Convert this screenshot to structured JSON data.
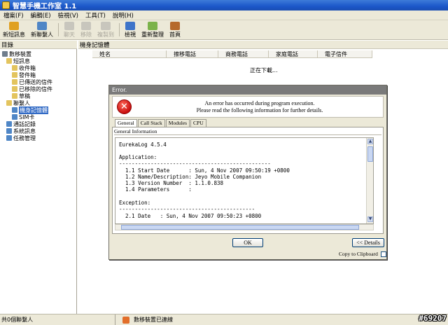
{
  "window": {
    "title": "智慧手機工作室 1.1"
  },
  "menu": [
    "檔案(F)",
    "編輯(E)",
    "檢視(V)",
    "工具(T)",
    "說明(H)"
  ],
  "toolbar": {
    "buttons": [
      {
        "label": "新短訊息",
        "icon": "new-message-icon",
        "disabled": false,
        "color": "#e0a020"
      },
      {
        "label": "新聯繫人",
        "icon": "new-contact-icon",
        "disabled": false,
        "color": "#4f86c6"
      },
      {
        "label": "聊天",
        "icon": "chat-icon",
        "disabled": true,
        "color": "#c8c6bd"
      },
      {
        "label": "移除",
        "icon": "delete-icon",
        "disabled": true,
        "color": "#c8c6bd"
      },
      {
        "label": "複製到",
        "icon": "copy-to-icon",
        "disabled": true,
        "color": "#c8c6bd"
      },
      {
        "label": "檢視",
        "icon": "view-icon",
        "disabled": false,
        "color": "#3e74c9"
      },
      {
        "label": "重新整理",
        "icon": "refresh-icon",
        "disabled": false,
        "color": "#7bb34a"
      },
      {
        "label": "首頁",
        "icon": "home-icon",
        "disabled": false,
        "color": "#b66a2c"
      }
    ]
  },
  "left_panel": {
    "header": "目錄",
    "tree": [
      {
        "label": "數移裝置",
        "indent": 0,
        "icon": "phone-icon",
        "color": "#6f7d8c"
      },
      {
        "label": "短訊息",
        "indent": 1,
        "icon": "folder-icon",
        "color": "#e3c45e"
      },
      {
        "label": "收件箱",
        "indent": 2,
        "icon": "inbox-icon",
        "color": "#e3c45e"
      },
      {
        "label": "發件箱",
        "indent": 2,
        "icon": "outbox-icon",
        "color": "#e3c45e"
      },
      {
        "label": "已傳送的信件",
        "indent": 2,
        "icon": "sent-icon",
        "color": "#e3c45e"
      },
      {
        "label": "已移除的信件",
        "indent": 2,
        "icon": "deleted-icon",
        "color": "#e3c45e"
      },
      {
        "label": "草稿",
        "indent": 2,
        "icon": "draft-icon",
        "color": "#e3c45e"
      },
      {
        "label": "聯繫人",
        "indent": 1,
        "icon": "contacts-folder-icon",
        "color": "#e3c45e"
      },
      {
        "label": "機身記憶體",
        "indent": 2,
        "icon": "phone-memory-icon",
        "color": "#4f86c6",
        "selected": true
      },
      {
        "label": "SIM卡",
        "indent": 2,
        "icon": "sim-card-icon",
        "color": "#4f86c6"
      },
      {
        "label": "通話記錄",
        "indent": 1,
        "icon": "call-log-icon",
        "color": "#4f86c6"
      },
      {
        "label": "系統訊息",
        "indent": 1,
        "icon": "system-info-icon",
        "color": "#4f86c6"
      },
      {
        "label": "任務管理",
        "indent": 1,
        "icon": "task-manager-icon",
        "color": "#4f86c6"
      }
    ]
  },
  "right_panel": {
    "header": "機身記憶體",
    "columns": [
      "姓名",
      "擦移電話",
      "商務電話",
      "家庭電話",
      "電子信件"
    ],
    "loading_text": "正在下載..."
  },
  "status": {
    "count": "共0個聯繫人",
    "connection": "數移裝置已連線"
  },
  "watermark": "#69207",
  "dialog": {
    "title": "Error.",
    "message_line1": "An error has occurred during program execution.",
    "message_line2": "Please read the following information for further details.",
    "tabs": [
      "General",
      "Call Stack",
      "Modules",
      "CPU"
    ],
    "active_tab": 0,
    "panel_label": "General Information",
    "log": [
      "EurekaLog 4.5.4",
      "",
      "Application:",
      "------------------------------------------------",
      "  1.1 Start Date      : Sun, 4 Nov 2007 09:50:19 +0800",
      "  1.2 Name/Description: Jeyo Mobile Companion",
      "  1.3 Version Number  : 1.1.0.838",
      "  1.4 Parameters      :",
      "",
      "Exception:",
      "-------------------------------------------",
      "  2.1 Date   : Sun, 4 Nov 2007 09:50:23 +0800"
    ],
    "ok_label": "OK",
    "details_label": "<< Details",
    "clipboard_label": "Copy to Clipboard"
  }
}
